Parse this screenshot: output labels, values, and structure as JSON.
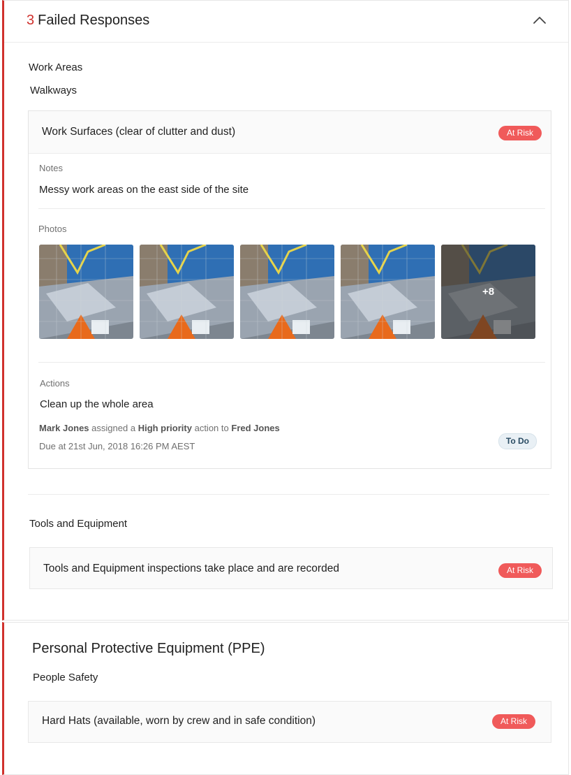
{
  "failed_section": {
    "count": "3",
    "title": "Failed Responses",
    "collapse_icon": "chevron-up-icon"
  },
  "work_areas": {
    "title": "Work Areas",
    "subsection": "Walkways",
    "item": {
      "question": "Work Surfaces (clear of clutter and dust)",
      "status": "At Risk",
      "notes_label": "Notes",
      "notes_text": "Messy work areas on the east side of the site",
      "photos_label": "Photos",
      "more_photos": "+8",
      "actions_label": "Actions",
      "action": {
        "title": "Clean up the whole area",
        "assigner": "Mark Jones",
        "assigned_text": "assigned a",
        "priority": "High priority",
        "action_to_text": "action to",
        "assignee": "Fred Jones",
        "due": "Due at 21st Jun, 2018 16:26 PM AEST",
        "status": "To Do"
      }
    }
  },
  "tools": {
    "title": "Tools and Equipment",
    "question": "Tools and Equipment inspections take place and are recorded",
    "status": "At Risk"
  },
  "ppe": {
    "title": "Personal Protective Equipment (PPE)",
    "subsection": "People Safety",
    "question": "Hard Hats (available, worn by crew and in safe condition)",
    "status": "At Risk"
  },
  "colors": {
    "accent_red": "#d0312d",
    "at_risk_badge": "#f05a5a",
    "todo_badge": "#e9f0f5"
  }
}
